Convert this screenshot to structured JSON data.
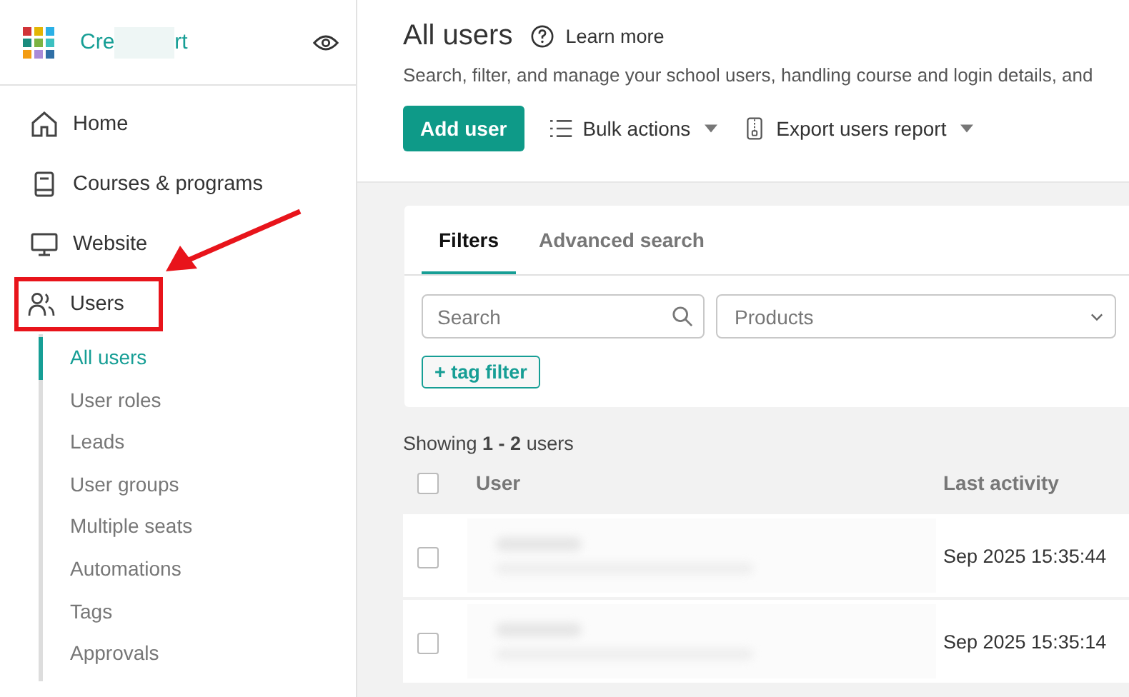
{
  "sidebar": {
    "brand_parts": [
      "Cre",
      "rt"
    ],
    "items": [
      {
        "label": "Home",
        "kind": "home",
        "highlighted": false
      },
      {
        "label": "Courses & programs",
        "kind": "book",
        "highlighted": false
      },
      {
        "label": "Website",
        "kind": "monitor",
        "highlighted": false
      },
      {
        "label": "Users",
        "kind": "users",
        "highlighted": true,
        "children": [
          {
            "label": "All users",
            "selected": true
          },
          {
            "label": "User roles",
            "selected": false
          },
          {
            "label": "Leads",
            "selected": false
          },
          {
            "label": "User groups",
            "selected": false
          },
          {
            "label": "Multiple seats",
            "selected": false
          },
          {
            "label": "Automations",
            "selected": false
          },
          {
            "label": "Tags",
            "selected": false
          },
          {
            "label": "Approvals",
            "selected": false
          }
        ]
      }
    ]
  },
  "header": {
    "title": "All users",
    "learn_more": "Learn more",
    "description": "Search, filter, and manage your school users, handling course and login details, and",
    "primary_button": "Add user",
    "menus": [
      {
        "label": "Bulk actions",
        "kind": "list"
      },
      {
        "label": "Export users report",
        "kind": "file"
      }
    ]
  },
  "filters": {
    "tabs": [
      {
        "label": "Filters",
        "selected": true
      },
      {
        "label": "Advanced search",
        "selected": false
      }
    ],
    "search": {
      "placeholder": "Search"
    },
    "products": {
      "placeholder": "Products"
    },
    "tag_filter": "+ tag filter"
  },
  "table": {
    "showing": "Showing **1 - 2** users",
    "columns": [
      "User",
      "Last activity"
    ],
    "all_checked": false,
    "rows": [
      {
        "checked": false,
        "last_activity": "Sep 2025 15:35:44"
      },
      {
        "checked": false,
        "last_activity": "Sep 2025 15:35:14"
      }
    ]
  }
}
